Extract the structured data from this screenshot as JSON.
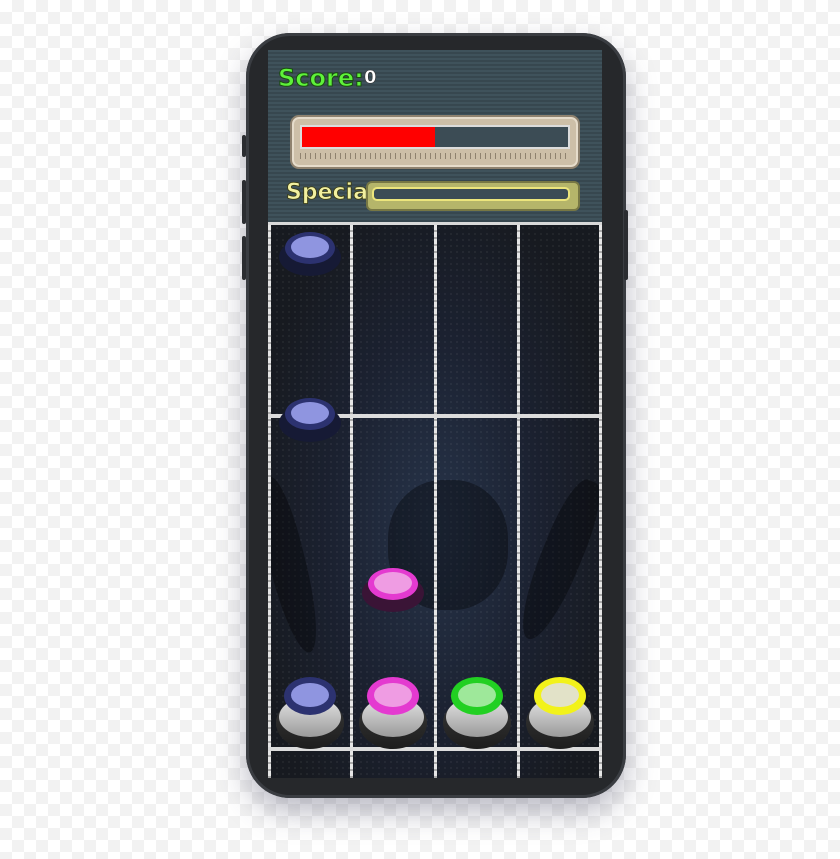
{
  "hud": {
    "score_label": "Score:",
    "score_value": "0",
    "health_fill_fraction": 0.5,
    "health_color": "#ff0000",
    "special_label": "Special",
    "special_fill_fraction": 0.0,
    "special_color": "#ece57c"
  },
  "lanes": [
    {
      "color_name": "blue",
      "cap": "#2c3270",
      "top": "#8f95e0"
    },
    {
      "color_name": "pink",
      "cap": "#e43ad0",
      "top": "#ef9ce3"
    },
    {
      "color_name": "green",
      "cap": "#22d022",
      "top": "#9ee89a"
    },
    {
      "color_name": "yellow",
      "cap": "#f2f21a",
      "top": "#e2e2c8"
    }
  ],
  "falling_notes": [
    {
      "lane": 0,
      "color_name": "blue"
    },
    {
      "lane": 0,
      "color_name": "blue"
    },
    {
      "lane": 1,
      "color_name": "pink"
    }
  ]
}
